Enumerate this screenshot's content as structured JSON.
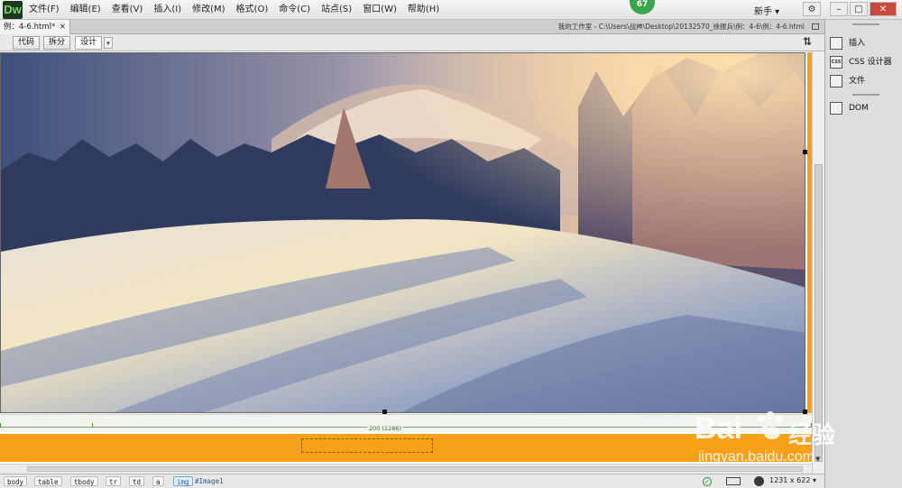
{
  "app": {
    "logo": "Dw",
    "workspace_label": "新手 ▾",
    "update_badge": "67"
  },
  "menu": [
    "文件(F)",
    "编辑(E)",
    "查看(V)",
    "插入(I)",
    "修改(M)",
    "格式(O)",
    "命令(C)",
    "站点(S)",
    "窗口(W)",
    "帮助(H)"
  ],
  "window_buttons": {
    "minimize": "–",
    "maximize": "□",
    "close": "✕"
  },
  "document": {
    "tab_label": "例：4-6.html*",
    "tab_close": "×",
    "path": "我的工作室 - C:\\Users\\战神\\Desktop\\20132570_徐振兵\\例：4-6\\例：4-6.html"
  },
  "toolbar": {
    "code": "代码",
    "split": "拆分",
    "design": "设计",
    "dropdown_arrow": "▾",
    "sort_icon": "⇅"
  },
  "ruler": {
    "label": "200 (1286)"
  },
  "status": {
    "tags": [
      "body",
      "table",
      "tbody",
      "tr",
      "td",
      "a",
      "img"
    ],
    "selected_tag": "img",
    "element_id": "#Image1",
    "dimensions": "1231 x 622 ▾",
    "check_mark": "✓"
  },
  "panel": {
    "items": [
      "插入",
      "CSS 设计器",
      "文件",
      "DOM"
    ],
    "css_icon": "CSS"
  },
  "watermark": {
    "brand_text": "Bai",
    "brand_suffix": "经验",
    "url": "jingyan.baidu.com"
  },
  "colors": {
    "accent_orange": "#f7a11a",
    "badge_green": "#3aa84a",
    "ruler_green": "#4c8d47",
    "logo_green": "#7fd36b"
  },
  "icons": {
    "insert": "insert-icon",
    "css_designer": "css-icon",
    "files": "files-icon",
    "dom": "dom-icon"
  }
}
